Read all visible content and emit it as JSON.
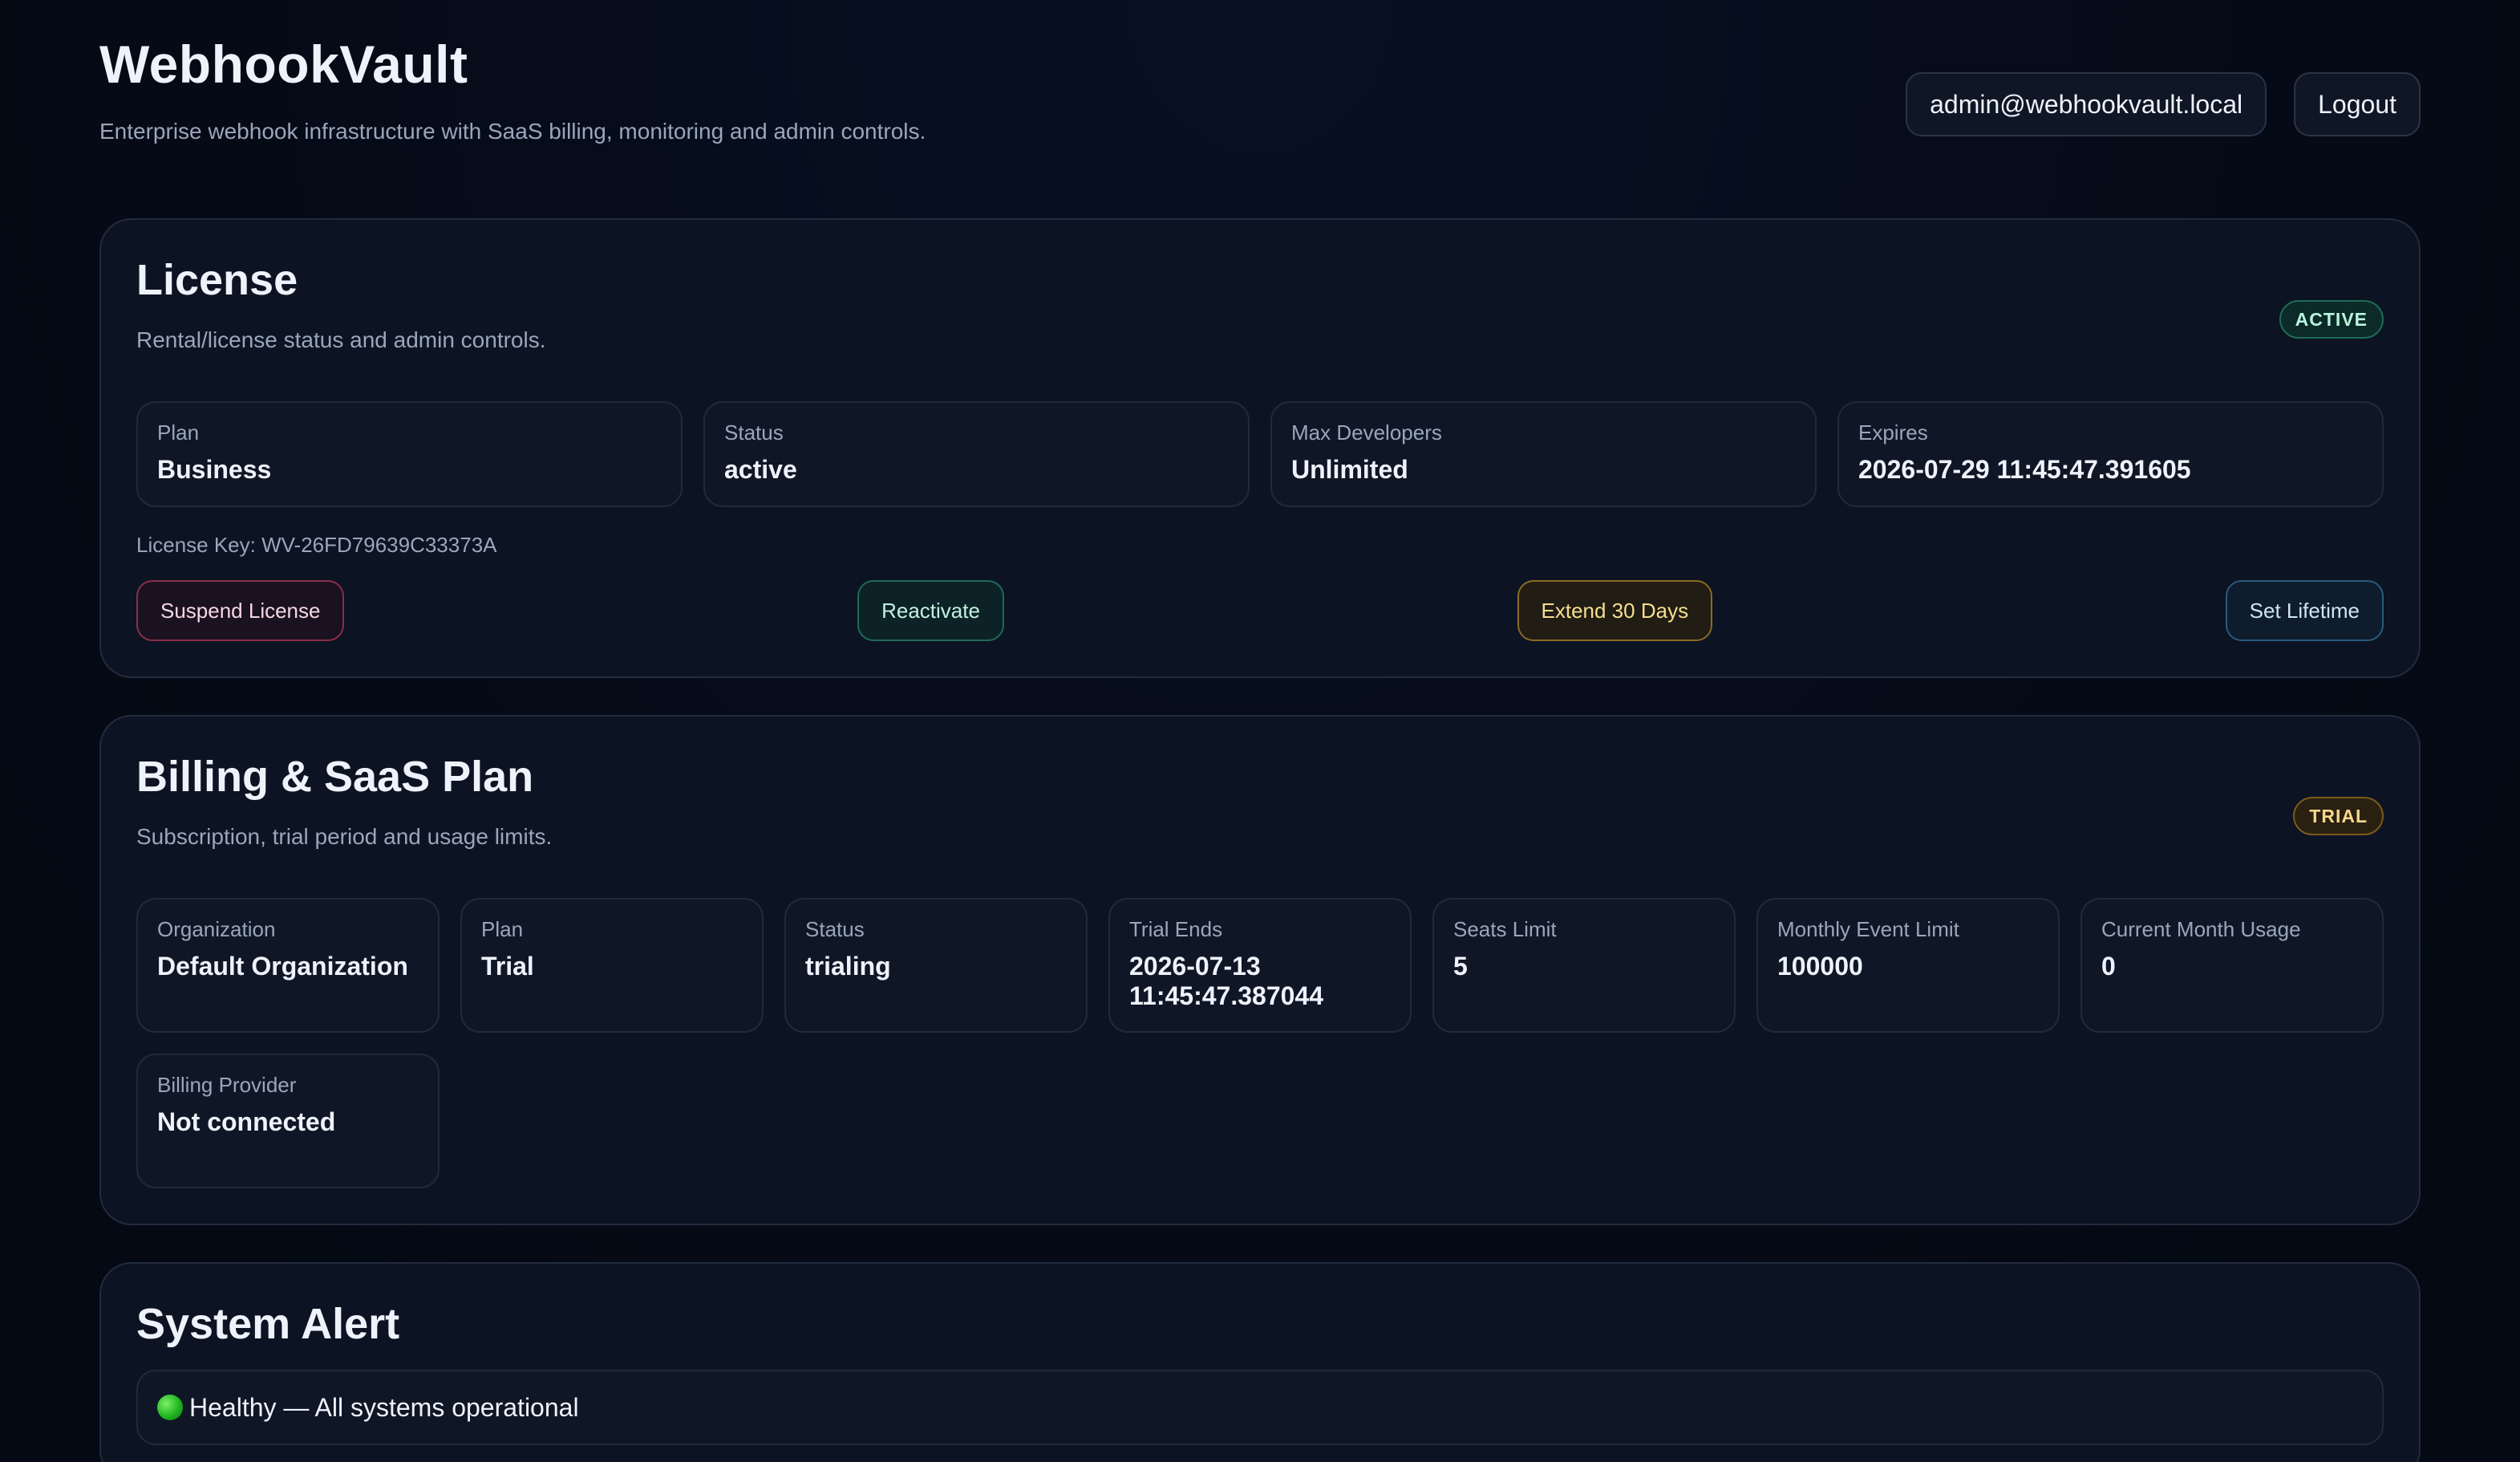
{
  "header": {
    "title": "WebhookVault",
    "subtitle": "Enterprise webhook infrastructure with SaaS billing, monitoring and admin controls.",
    "user_email": "admin@webhookvault.local",
    "logout_label": "Logout"
  },
  "license": {
    "title": "License",
    "description": "Rental/license status and admin controls.",
    "badge": "ACTIVE",
    "stats": [
      {
        "label": "Plan",
        "value": "Business"
      },
      {
        "label": "Status",
        "value": "active"
      },
      {
        "label": "Max Developers",
        "value": "Unlimited"
      },
      {
        "label": "Expires",
        "value": "2026-07-29 11:45:47.391605"
      }
    ],
    "license_key": "License Key: WV-26FD79639C33373A",
    "actions": {
      "suspend": "Suspend License",
      "reactivate": "Reactivate",
      "extend": "Extend 30 Days",
      "lifetime": "Set Lifetime"
    }
  },
  "billing": {
    "title": "Billing & SaaS Plan",
    "description": "Subscription, trial period and usage limits.",
    "badge": "TRIAL",
    "stats": [
      {
        "label": "Organization",
        "value": "Default Organization"
      },
      {
        "label": "Plan",
        "value": "Trial"
      },
      {
        "label": "Status",
        "value": "trialing"
      },
      {
        "label": "Trial Ends",
        "value": "2026-07-13 11:45:47.387044"
      },
      {
        "label": "Seats Limit",
        "value": "5"
      },
      {
        "label": "Monthly Event Limit",
        "value": "100000"
      },
      {
        "label": "Current Month Usage",
        "value": "0"
      },
      {
        "label": "Billing Provider",
        "value": "Not connected"
      }
    ]
  },
  "system_alert": {
    "title": "System Alert",
    "status_color": "#21b51f",
    "message": "Healthy — All systems operational"
  }
}
